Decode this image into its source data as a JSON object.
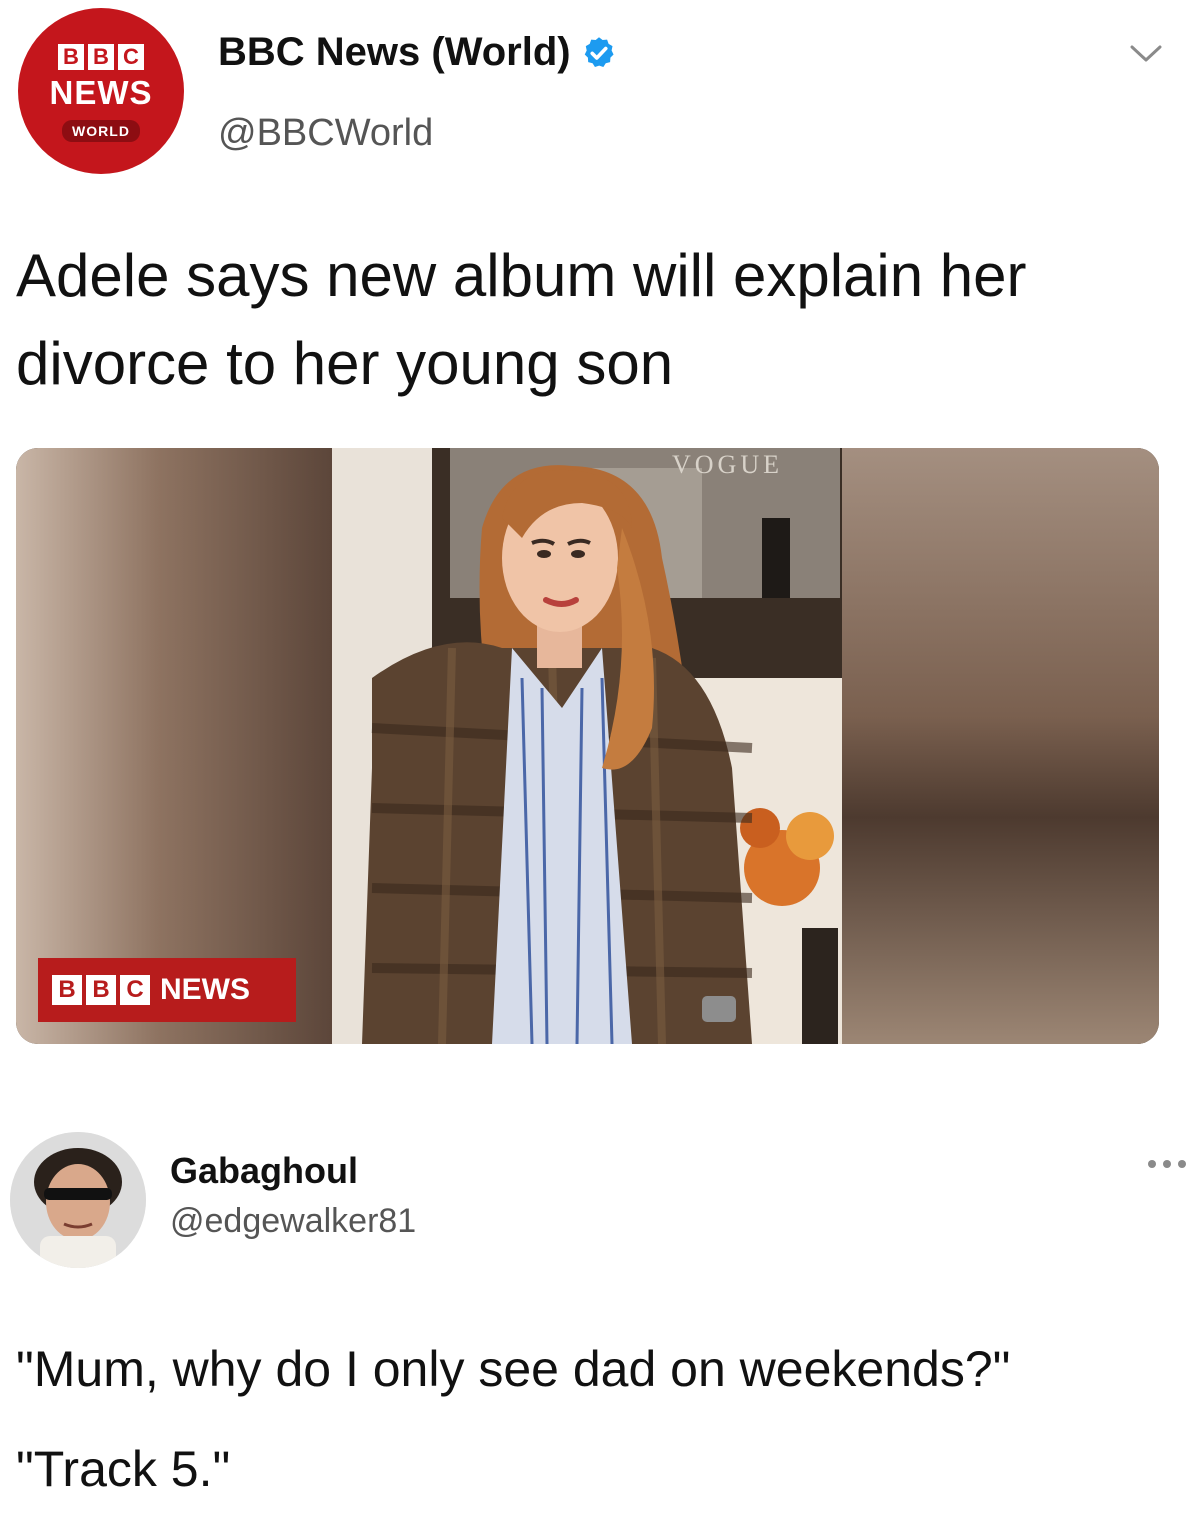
{
  "tweet": {
    "avatar": {
      "logo_letters": [
        "B",
        "B",
        "C"
      ],
      "logo_word": "NEWS",
      "logo_sub": "WORLD"
    },
    "display_name": "BBC News (World)",
    "handle": "@BBCWorld",
    "verified": true,
    "menu_icon": "chevron-down-icon",
    "headline": "Adele says new album will explain her divorce to her young son",
    "media": {
      "overlay_letters": [
        "B",
        "B",
        "C"
      ],
      "overlay_word": "NEWS",
      "magazine_mark": "VOGUE"
    }
  },
  "reply": {
    "display_name": "Gabaghoul",
    "handle": "@edgewalker81",
    "menu_icon": "more-horizontal-icon",
    "line1": "\"Mum, why do I only see dad on weekends?\"",
    "line2": "\"Track 5.\""
  },
  "colors": {
    "bbc_red": "#c4161c",
    "verified_blue": "#1d9bf0",
    "handle_gray": "#555555"
  }
}
